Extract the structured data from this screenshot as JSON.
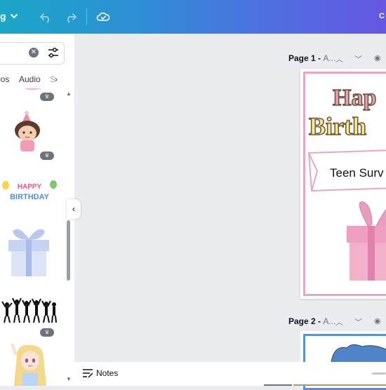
{
  "topbar": {
    "menu_label": "g",
    "right_label": "C",
    "icons": [
      "chevron-down-icon",
      "undo-icon",
      "redo-icon",
      "cloud-check-icon"
    ],
    "colors": {
      "gradient_start": "#1aa6c7",
      "gradient_end": "#6657e3"
    }
  },
  "panel": {
    "tabs": [
      "eos",
      "Audio",
      "S"
    ],
    "search_icons": [
      "clear-icon",
      "filter-icon"
    ],
    "stickers": [
      {
        "name": "pink-sticker-partial"
      },
      {
        "name": "party-girl-sticker",
        "premium": true
      },
      {
        "name": "happy-birthday-balloons-sticker",
        "premium": false
      },
      {
        "name": "blue-gift-box-sticker",
        "premium": false
      },
      {
        "name": "celebration-silhouettes-sticker",
        "premium": true
      },
      {
        "name": "anime-girl-sticker",
        "premium": false
      }
    ]
  },
  "canvas": {
    "page1": {
      "label": "Page 1 -",
      "dim": "A..."
    },
    "page2": {
      "label": "Page 2 -",
      "dim": "A..."
    },
    "design": {
      "title_line1": "Hap",
      "title_line2": "Birth",
      "banner_text": "Teen Surv",
      "colors": {
        "pink": "#e79cc0",
        "yellow": "#f3eb95",
        "brown": "#6d5334",
        "frame_pink": "#e7a6c2",
        "frame_blue": "#5a8fd0"
      }
    }
  },
  "bottom": {
    "notes_label": "Notes"
  }
}
